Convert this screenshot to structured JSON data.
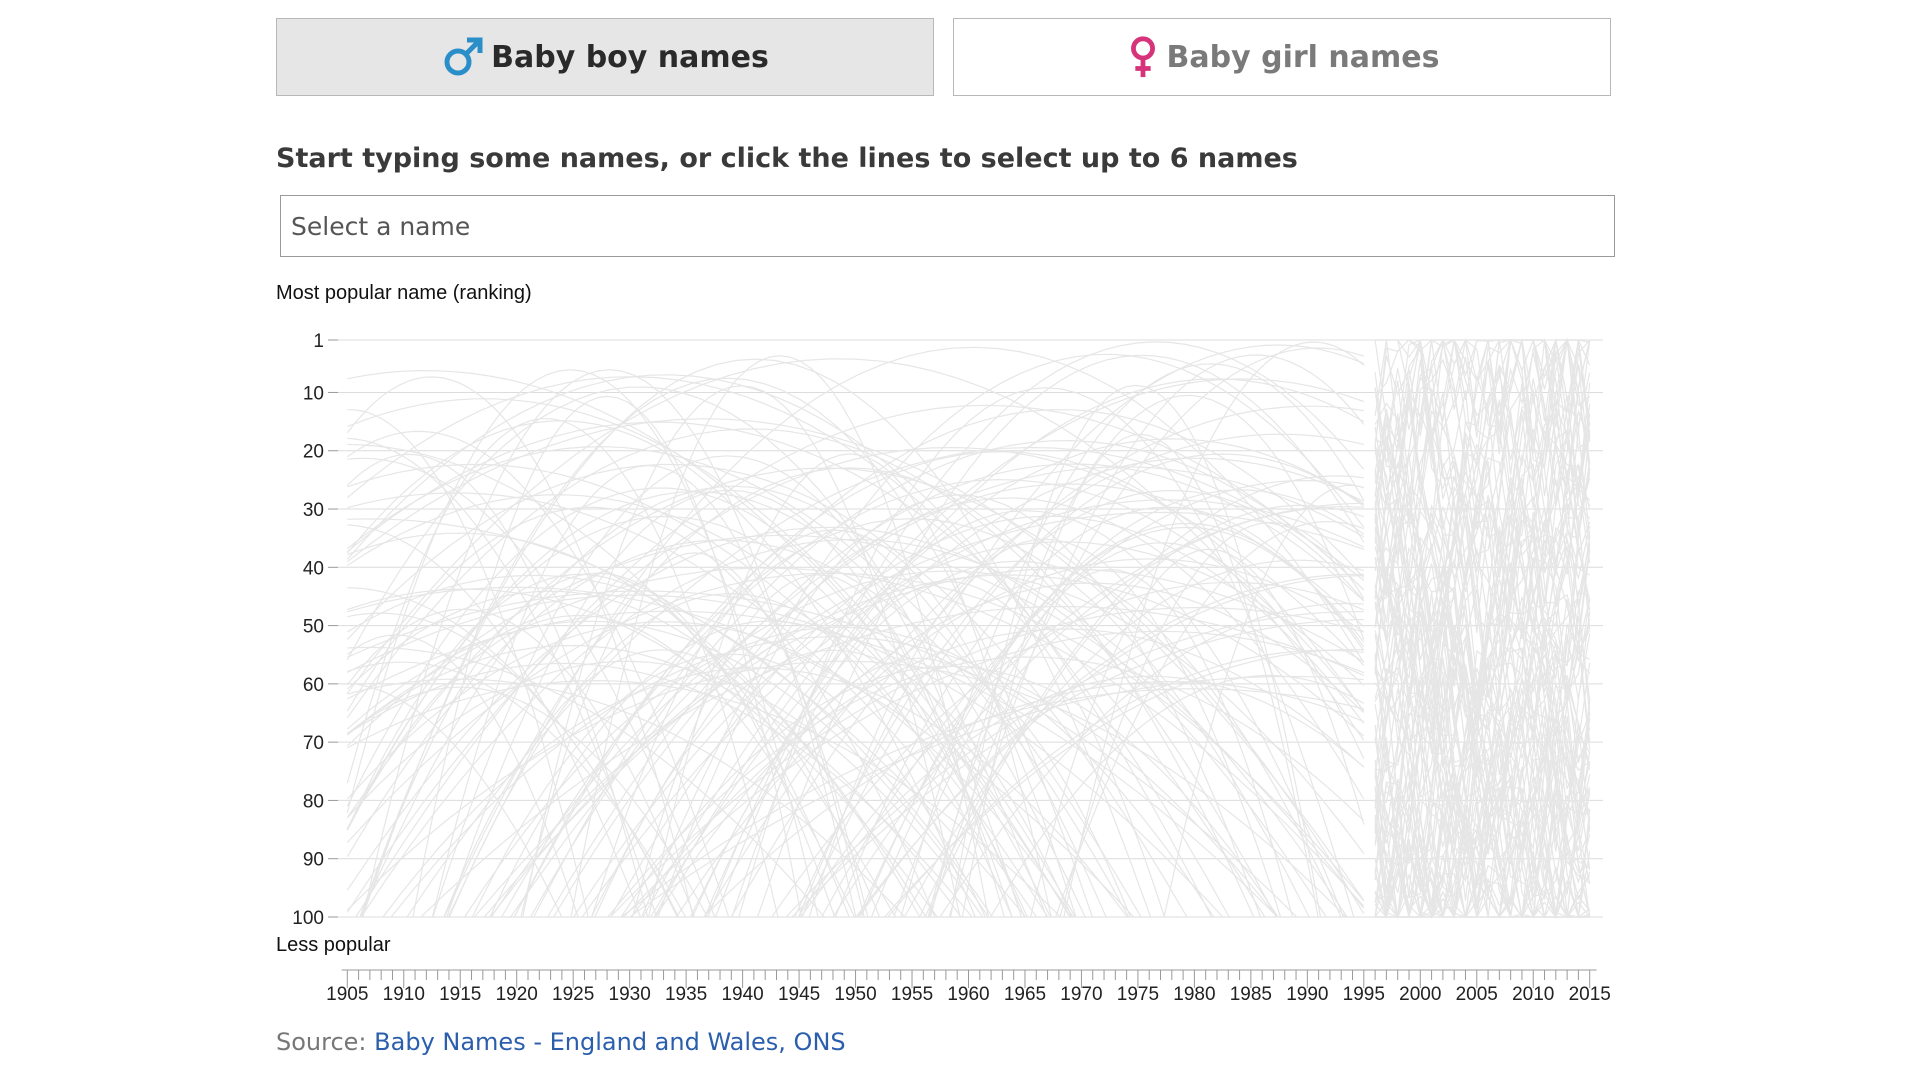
{
  "tabs": {
    "boy_label": "Baby boy names",
    "girl_label": "Baby girl names",
    "boy_color": "#2a8ec9",
    "girl_color": "#d6337a",
    "boy_icon": "male-symbol-icon",
    "girl_icon": "female-symbol-icon",
    "selected": "boy"
  },
  "prompt": "Start typing some names, or click the lines to select up to 6 names",
  "search": {
    "placeholder": "Select a name",
    "value": ""
  },
  "source": {
    "prefix": "Source: ",
    "link_text": "Baby Names - England and Wales, ONS"
  },
  "chart_data": {
    "type": "line",
    "ylabel_top": "Most popular name (ranking)",
    "ylabel_bottom": "Less popular",
    "y_ticks": [
      1,
      10,
      20,
      30,
      40,
      50,
      60,
      70,
      80,
      90,
      100
    ],
    "y_range": [
      1,
      100
    ],
    "y_inverted": true,
    "x_ticks": [
      1905,
      1910,
      1915,
      1920,
      1925,
      1930,
      1935,
      1940,
      1945,
      1950,
      1955,
      1960,
      1965,
      1970,
      1975,
      1980,
      1985,
      1990,
      1995,
      2000,
      2005,
      2010,
      2015
    ],
    "x_range": [
      1904,
      2016
    ],
    "grid": true,
    "line_color": "#e6e6e6",
    "grid_color": "#dcdcdc"
  }
}
